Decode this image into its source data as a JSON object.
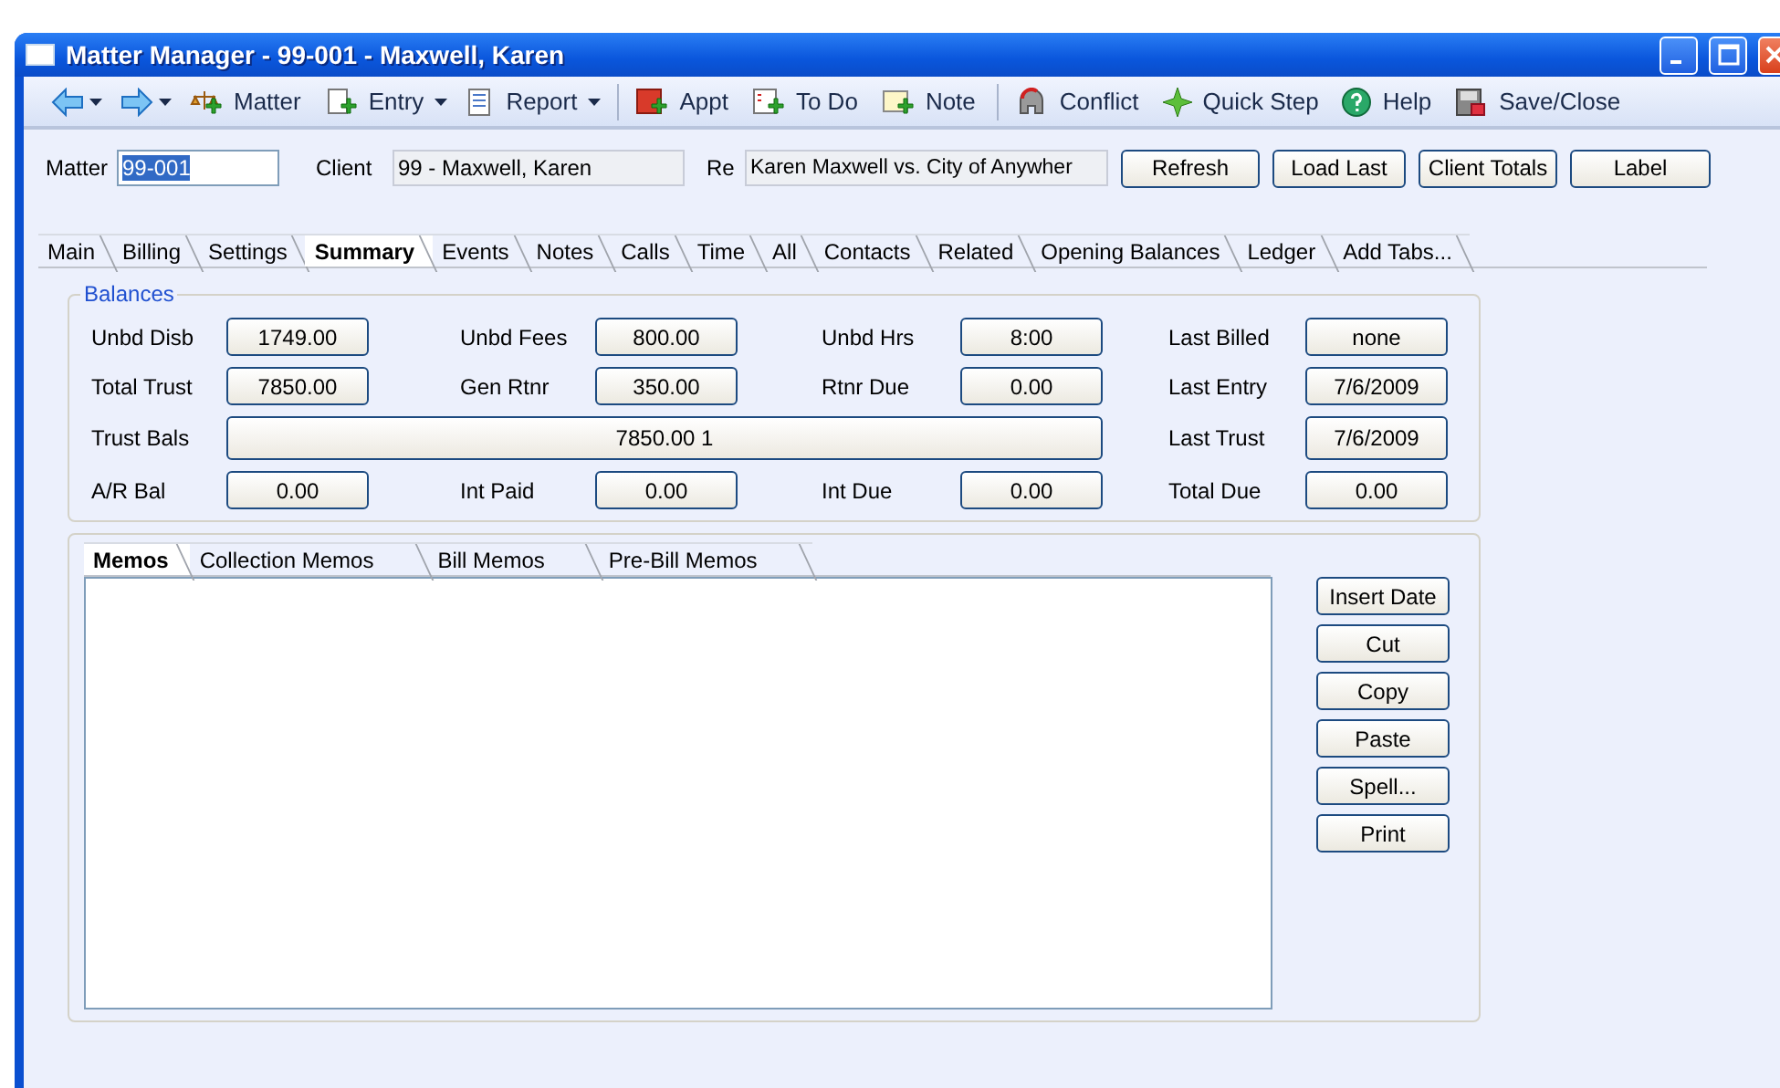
{
  "window": {
    "title": "Matter Manager - 99-001 - Maxwell, Karen"
  },
  "toolbar": {
    "items": [
      {
        "kind": "back",
        "dropdown": true
      },
      {
        "kind": "forward",
        "dropdown": true
      },
      {
        "kind": "matter",
        "label": "Matter"
      },
      {
        "kind": "entry",
        "label": "Entry",
        "dropdown": true
      },
      {
        "kind": "report",
        "label": "Report",
        "dropdown": true
      },
      {
        "kind": "separator"
      },
      {
        "kind": "appt",
        "label": "Appt"
      },
      {
        "kind": "todo",
        "label": "To Do"
      },
      {
        "kind": "note",
        "label": "Note"
      },
      {
        "kind": "separator"
      },
      {
        "kind": "conflict",
        "label": "Conflict"
      },
      {
        "kind": "quickstep",
        "label": "Quick Step"
      },
      {
        "kind": "help",
        "label": "Help"
      },
      {
        "kind": "save",
        "label": "Save/Close"
      }
    ]
  },
  "header": {
    "matter": {
      "label": "Matter",
      "value": "99-001",
      "selected": true
    },
    "client": {
      "label": "Client",
      "value": "99 - Maxwell, Karen"
    },
    "re": {
      "label": "Re",
      "value": "Karen Maxwell vs. City of Anywher"
    },
    "buttons": [
      "Refresh",
      "Load Last",
      "Client Totals",
      "Label"
    ]
  },
  "tabs": [
    {
      "label": "Main",
      "selected": false
    },
    {
      "label": "Billing",
      "selected": false
    },
    {
      "label": "Settings",
      "selected": false
    },
    {
      "label": "Summary",
      "selected": true
    },
    {
      "label": "Events",
      "selected": false
    },
    {
      "label": "Notes",
      "selected": false
    },
    {
      "label": "Calls",
      "selected": false
    },
    {
      "label": "Time",
      "selected": false
    },
    {
      "label": "All",
      "selected": false
    },
    {
      "label": "Contacts",
      "selected": false
    },
    {
      "label": "Related",
      "selected": false
    },
    {
      "label": "Opening Balances",
      "selected": false
    },
    {
      "label": "Ledger",
      "selected": false
    },
    {
      "label": "Add Tabs...",
      "selected": false
    }
  ],
  "balances": {
    "title": "Balances",
    "rows": [
      [
        {
          "kind": "field",
          "label": "Unbd Disb",
          "value": "1749.00"
        },
        {
          "kind": "field",
          "label": "Unbd Fees",
          "value": "800.00"
        },
        {
          "kind": "field",
          "label": "Unbd Hrs",
          "value": "8:00"
        },
        {
          "kind": "field",
          "label": "Last Billed",
          "value": "none"
        }
      ],
      [
        {
          "kind": "field",
          "label": "Total Trust",
          "value": "7850.00"
        },
        {
          "kind": "field",
          "label": "Gen Rtnr",
          "value": "350.00"
        },
        {
          "kind": "field",
          "label": "Rtnr Due",
          "value": "0.00"
        },
        {
          "kind": "field",
          "label": "Last Entry",
          "value": "7/6/2009"
        }
      ],
      [
        {
          "kind": "wide",
          "label": "Trust Bals",
          "value": "7850.00  1"
        },
        "",
        "",
        {
          "kind": "field",
          "label": "Last Trust",
          "value": "7/6/2009"
        }
      ],
      [
        {
          "kind": "field",
          "label": "A/R Bal",
          "value": "0.00"
        },
        {
          "kind": "field",
          "label": "Int Paid",
          "value": "0.00"
        },
        {
          "kind": "field",
          "label": "Int Due",
          "value": "0.00"
        },
        {
          "kind": "field",
          "label": "Total Due",
          "value": "0.00"
        }
      ]
    ]
  },
  "memos": {
    "tabs": [
      {
        "label": "Memos",
        "selected": true
      },
      {
        "label": "Collection Memos",
        "selected": false
      },
      {
        "label": "Bill Memos",
        "selected": false
      },
      {
        "label": "Pre-Bill Memos",
        "selected": false
      }
    ],
    "buttons": [
      "Insert Date",
      "Cut",
      "Copy",
      "Paste",
      "Spell...",
      "Print"
    ]
  }
}
